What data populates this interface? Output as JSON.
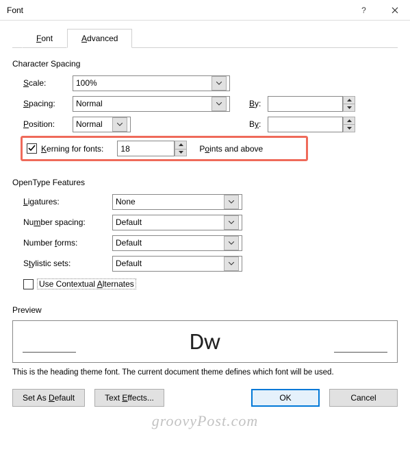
{
  "title": "Font",
  "tabs": {
    "font": "Font",
    "advanced": "Advanced",
    "font_u": "F",
    "advanced_u": "A"
  },
  "group1": "Character Spacing",
  "scale_label": "cale:",
  "scale_u": "S",
  "scale_value": "100%",
  "spacing_label": "pacing:",
  "spacing_u": "S",
  "spacing_value": "Normal",
  "position_label": "osition:",
  "position_u": "P",
  "position_value": "Normal",
  "by_label": "y:",
  "by_u": "B",
  "by1_value": "",
  "by2_value": "",
  "kerning_u": "K",
  "kerning_label": "erning for fonts:",
  "kerning_value": "18",
  "kerning_suffix_pre": "P",
  "kerning_suffix_u": "o",
  "kerning_suffix_post": "ints and above",
  "group2": "OpenType Features",
  "ligatures_u": "L",
  "ligatures_label": "igatures:",
  "ligatures_value": "None",
  "numsp_label_pre": "Nu",
  "numsp_u": "m",
  "numsp_label_post": "ber spacing:",
  "numsp_value": "Default",
  "numfm_label_pre": "Number ",
  "numfm_u": "f",
  "numfm_label_post": "orms:",
  "numfm_value": "Default",
  "stylistic_label_pre": "S",
  "stylistic_u": "t",
  "stylistic_label_post": "ylistic sets:",
  "stylistic_value": "Default",
  "contextual_label_pre": "Use Contextual ",
  "contextual_u": "A",
  "contextual_label_post": "lternates",
  "preview_label": "Preview",
  "preview_text": "Dw",
  "preview_desc": "This is the heading theme font. The current document theme defines which font will be used.",
  "btn_default_pre": "Set As ",
  "btn_default_u": "D",
  "btn_default_post": "efault",
  "btn_effects_pre": "Text ",
  "btn_effects_u": "E",
  "btn_effects_post": "ffects...",
  "btn_ok": "OK",
  "btn_cancel": "Cancel",
  "watermark": "groovyPost.com"
}
